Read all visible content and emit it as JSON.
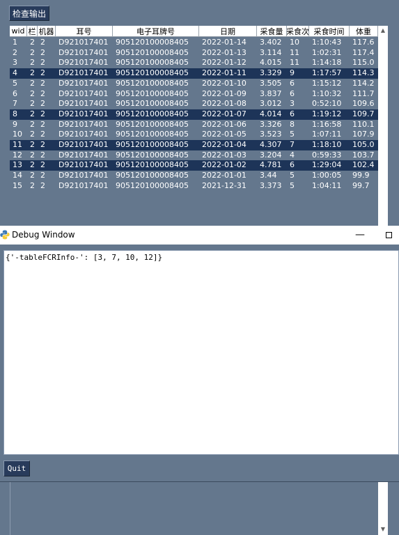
{
  "main": {
    "check_button": "检查输出",
    "columns": [
      "wid",
      "栏",
      "机器",
      "耳号",
      "电子耳牌号",
      "日期",
      "采食量",
      "采食次",
      "采食时间",
      "体重"
    ],
    "selected_rows": [
      3,
      7,
      10,
      12
    ],
    "rows": [
      [
        "1",
        "2",
        "2",
        "D921017401",
        "905120100008405",
        "2022-01-14",
        "3.402",
        "10",
        "1:10:43",
        "117.6"
      ],
      [
        "2",
        "2",
        "2",
        "D921017401",
        "905120100008405",
        "2022-01-13",
        "3.114",
        "11",
        "1:02:31",
        "117.4"
      ],
      [
        "3",
        "2",
        "2",
        "D921017401",
        "905120100008405",
        "2022-01-12",
        "4.015",
        "11",
        "1:14:18",
        "115.0"
      ],
      [
        "4",
        "2",
        "2",
        "D921017401",
        "905120100008405",
        "2022-01-11",
        "3.329",
        "9",
        "1:17:57",
        "114.3"
      ],
      [
        "5",
        "2",
        "2",
        "D921017401",
        "905120100008405",
        "2022-01-10",
        "3.505",
        "6",
        "1:15:12",
        "114.2"
      ],
      [
        "6",
        "2",
        "2",
        "D921017401",
        "905120100008405",
        "2022-01-09",
        "3.837",
        "6",
        "1:10:32",
        "111.7"
      ],
      [
        "7",
        "2",
        "2",
        "D921017401",
        "905120100008405",
        "2022-01-08",
        "3.012",
        "3",
        "0:52:10",
        "109.6"
      ],
      [
        "8",
        "2",
        "2",
        "D921017401",
        "905120100008405",
        "2022-01-07",
        "4.014",
        "6",
        "1:19:12",
        "109.7"
      ],
      [
        "9",
        "2",
        "2",
        "D921017401",
        "905120100008405",
        "2022-01-06",
        "3.326",
        "8",
        "1:16:58",
        "110.1"
      ],
      [
        "10",
        "2",
        "2",
        "D921017401",
        "905120100008405",
        "2022-01-05",
        "3.523",
        "5",
        "1:07:11",
        "107.9"
      ],
      [
        "11",
        "2",
        "2",
        "D921017401",
        "905120100008405",
        "2022-01-04",
        "4.307",
        "7",
        "1:18:10",
        "105.0"
      ],
      [
        "12",
        "2",
        "2",
        "D921017401",
        "905120100008405",
        "2022-01-03",
        "3.204",
        "4",
        "0:59:33",
        "103.7"
      ],
      [
        "13",
        "2",
        "2",
        "D921017401",
        "905120100008405",
        "2022-01-02",
        "4.781",
        "6",
        "1:29:04",
        "102.4"
      ],
      [
        "14",
        "2",
        "2",
        "D921017401",
        "905120100008405",
        "2022-01-01",
        "3.44",
        "5",
        "1:00:05",
        "99.9"
      ],
      [
        "15",
        "2",
        "2",
        "D921017401",
        "905120100008405",
        "2021-12-31",
        "3.373",
        "5",
        "1:04:11",
        "99.7"
      ]
    ]
  },
  "debug": {
    "title": "Debug Window",
    "minimize_glyph": "—",
    "output": "{'-tableFCRInfo-': [3, 7, 10, 12]}",
    "quit_label": "Quit"
  },
  "icons": {
    "app": "python-logo-icon",
    "minimize": "minimize-icon",
    "maximize": "maximize-icon",
    "scroll_up": "scroll-up-arrow-icon",
    "scroll_down": "scroll-down-arrow-icon"
  },
  "colors": {
    "background": "#64778d",
    "button": "#283b5b",
    "selected_row": "#1d3458"
  }
}
